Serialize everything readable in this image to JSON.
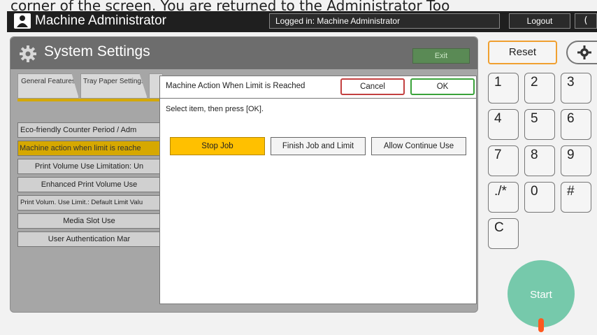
{
  "caption": "corner of the screen. You are returned to the Administrator Too",
  "header": {
    "user_icon": "user-icon",
    "title": "Machine Administrator",
    "logged_in": "Logged in: Machine Administrator",
    "logout_label": "Logout",
    "moon_icon": "moon-icon",
    "moon_glyph": "("
  },
  "panel": {
    "title": "System Settings",
    "exit_label": "Exit",
    "tabs": [
      {
        "label": "General Features"
      },
      {
        "label": "Tray Paper Settings"
      }
    ],
    "menu": [
      "Eco-friendly Counter Period / Adm",
      "Machine action when limit is reache",
      "Print Volume Use Limitation: Un",
      "Enhanced Print Volume Use",
      "Print Volum. Use Limit.: Default Limit Valu",
      "Media Slot Use",
      "User Authentication Mar"
    ]
  },
  "dialog": {
    "title": "Machine Action When Limit is Reached",
    "cancel_label": "Cancel",
    "ok_label": "OK",
    "instruction": "Select item, then press [OK].",
    "options": [
      "Stop Job",
      "Finish Job and Limit",
      "Allow Continue Use"
    ],
    "selected": "Stop Job"
  },
  "keypad": {
    "reset_label": "Reset",
    "gear_icon": "gear-icon",
    "keys": [
      "1",
      "2",
      "3",
      "4",
      "5",
      "6",
      "7",
      "8",
      "9",
      "./*",
      "0",
      "#",
      "C"
    ],
    "start_label": "Start"
  },
  "colors": {
    "accent_yellow": "#ffc000",
    "selected_menu": "#d6a800",
    "start_green": "#76c9ab",
    "cancel_red": "#c24040",
    "ok_green": "#3aa23a",
    "reset_orange": "#f0a030"
  }
}
